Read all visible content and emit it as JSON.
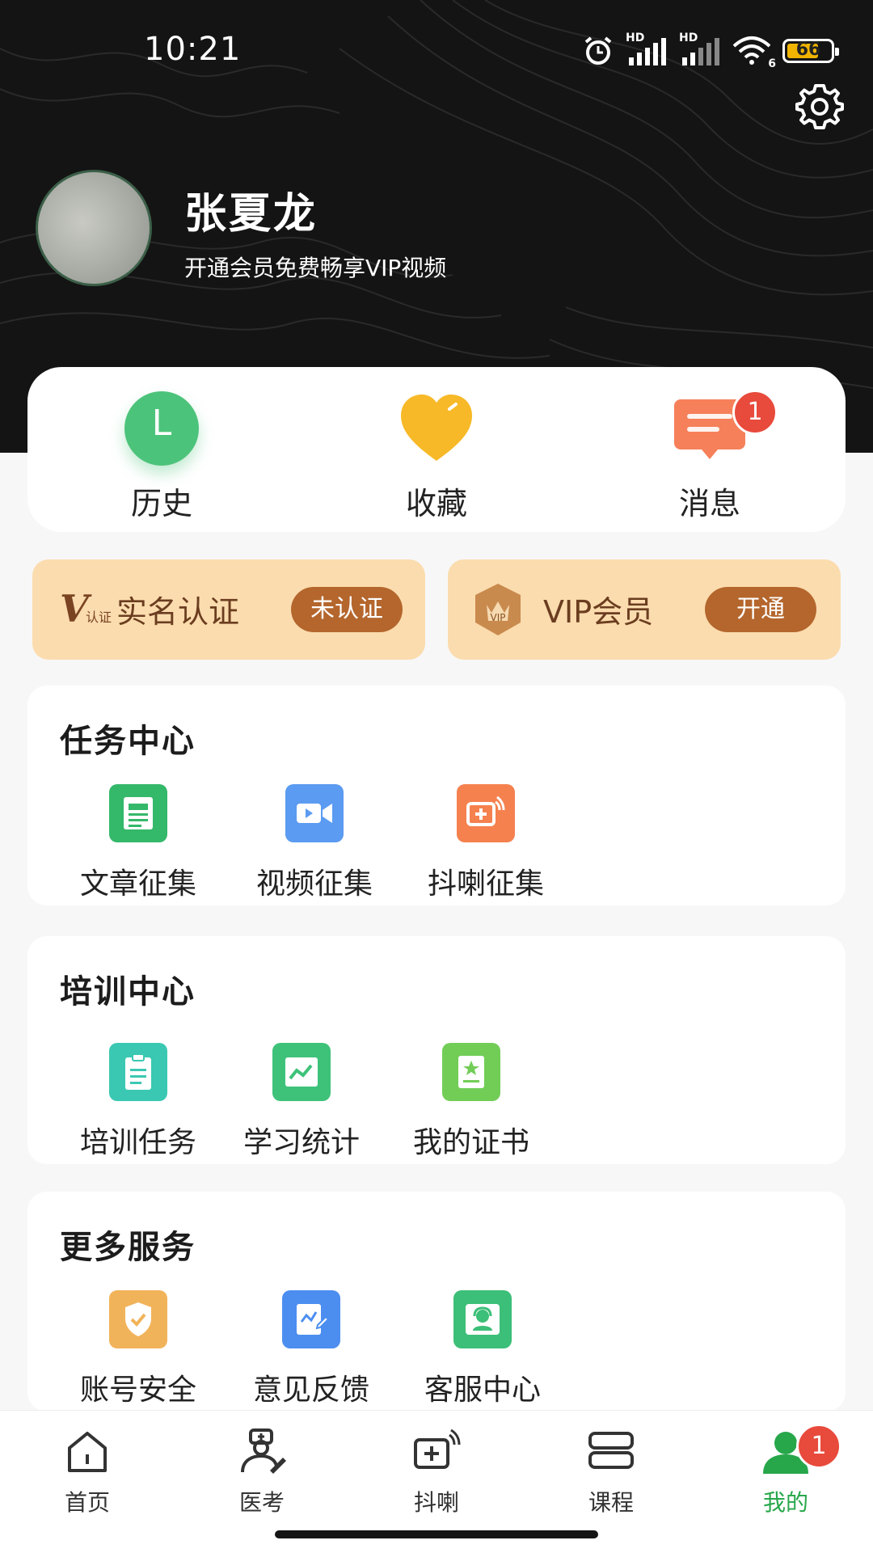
{
  "status_bar": {
    "time": "10:21",
    "battery": "66",
    "signal_label_1": "HD",
    "signal_label_2": "HD",
    "wifi_label": "6",
    "icons": [
      "alarm-icon",
      "signal-icon",
      "signal-icon",
      "wifi-icon",
      "battery-icon"
    ]
  },
  "header": {
    "user_name": "张夏龙",
    "subtitle": "开通会员免费畅享VIP视频",
    "settings_icon": "gear-icon"
  },
  "quick_actions": [
    {
      "label": "历史",
      "icon": "history-icon",
      "icon_letter": "L",
      "color": "#4cc37a"
    },
    {
      "label": "收藏",
      "icon": "heart-icon",
      "color": "#f7b928"
    },
    {
      "label": "消息",
      "icon": "message-icon",
      "color": "#f6805a",
      "badge": "1"
    }
  ],
  "promos": [
    {
      "title": "实名认证",
      "button": "未认证",
      "icon": "verify-icon",
      "icon_text": "认证"
    },
    {
      "title": "VIP会员",
      "button": "开通",
      "icon": "vip-crown-icon",
      "icon_text": "VIP"
    }
  ],
  "sections": [
    {
      "title": "任务中心",
      "items": [
        {
          "label": "文章征集",
          "icon": "news-icon",
          "color": "#34b86a"
        },
        {
          "label": "视频征集",
          "icon": "video-icon",
          "color": "#5b9bf1"
        },
        {
          "label": "抖喇征集",
          "icon": "broadcast-icon",
          "color": "#f5814f"
        }
      ]
    },
    {
      "title": "培训中心",
      "items": [
        {
          "label": "培训任务",
          "icon": "clipboard-icon",
          "color": "#3bc8b2"
        },
        {
          "label": "学习统计",
          "icon": "stats-icon",
          "color": "#3ec27a"
        },
        {
          "label": "我的证书",
          "icon": "certificate-icon",
          "color": "#72cd57"
        }
      ]
    },
    {
      "title": "更多服务",
      "items": [
        {
          "label": "账号安全",
          "icon": "shield-icon",
          "color": "#f1b35a"
        },
        {
          "label": "意见反馈",
          "icon": "feedback-icon",
          "color": "#4c8ef0"
        },
        {
          "label": "客服中心",
          "icon": "support-icon",
          "color": "#3cbf78"
        }
      ]
    }
  ],
  "tabs": [
    {
      "label": "首页",
      "icon": "home-icon"
    },
    {
      "label": "医考",
      "icon": "doctor-icon"
    },
    {
      "label": "抖喇",
      "icon": "broadcast-icon"
    },
    {
      "label": "课程",
      "icon": "course-icon"
    },
    {
      "label": "我的",
      "icon": "profile-icon",
      "active": true,
      "badge": "1"
    }
  ],
  "colors": {
    "header_bg": "#141414",
    "accent_green": "#27a74a",
    "promo_bg": "#fbdcae",
    "promo_button": "#b4662d",
    "badge_red": "#e84a3c"
  }
}
